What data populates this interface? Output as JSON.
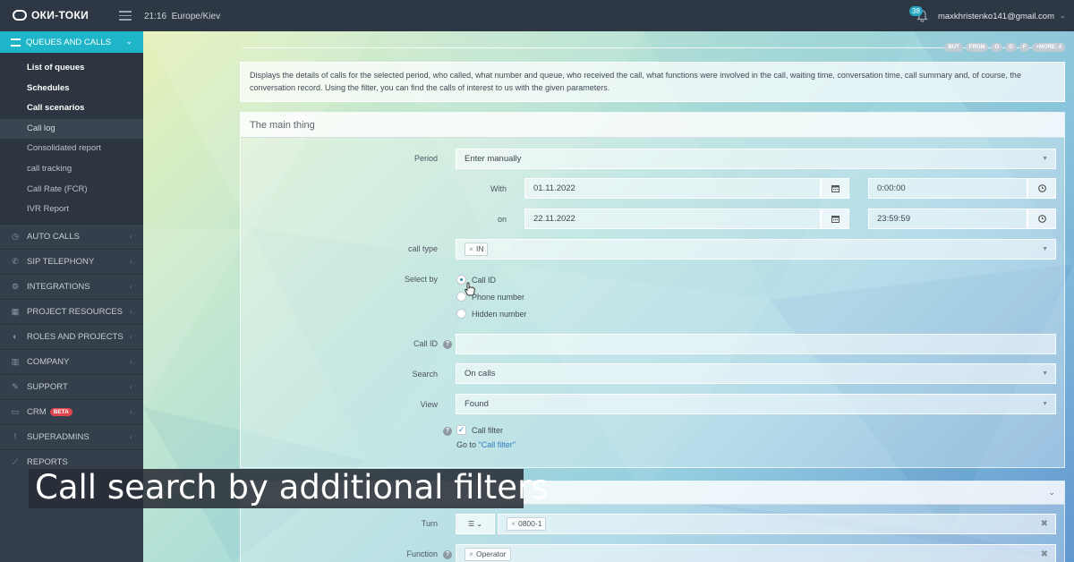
{
  "app": {
    "logo": "ОКИ-ТОКИ",
    "time": "21:16",
    "timezone": "Europe/Kiev"
  },
  "header": {
    "notifications": "38",
    "user": "maxkhristenko141@gmail.com"
  },
  "sidebar": {
    "active": {
      "label": "QUEUES AND CALLS",
      "icon": "list-icon"
    },
    "subitems": [
      {
        "label": "List of queues"
      },
      {
        "label": "Schedules"
      },
      {
        "label": "Call scenarios"
      },
      {
        "label": "Call log"
      },
      {
        "label": "Consolidated report"
      },
      {
        "label": "call tracking"
      },
      {
        "label": "Call Rate (FCR)"
      },
      {
        "label": "IVR Report"
      }
    ],
    "items": [
      {
        "label": "AUTO CALLS",
        "icon": "clock-icon"
      },
      {
        "label": "SIP TELEPHONY",
        "icon": "phone-icon"
      },
      {
        "label": "INTEGRATIONS",
        "icon": "gears-icon"
      },
      {
        "label": "PROJECT RESOURCES",
        "icon": "grid-icon"
      },
      {
        "label": "ROLES AND PROJECTS",
        "icon": "toggle-icon"
      },
      {
        "label": "COMPANY",
        "icon": "chart-icon"
      },
      {
        "label": "SUPPORT",
        "icon": "wrench-icon"
      },
      {
        "label": "CRM",
        "icon": "crm-icon",
        "badge": "BETA"
      },
      {
        "label": "SUPERADMINS",
        "icon": "exclamation-icon"
      },
      {
        "label": "REPORTS",
        "icon": "line-chart-icon"
      }
    ]
  },
  "pills": [
    "BUT",
    "FROM",
    "O",
    "G",
    "F",
    "+MORE: 4"
  ],
  "description": "Displays the details of calls for the selected period, who called, what number and queue, who received the call, what functions were involved in the call, waiting time, conversation time, call summary and, of course, the conversation record. Using the filter, you can find the calls of interest to us with the given parameters.",
  "form": {
    "title": "The main thing",
    "period_label": "Period",
    "period_value": "Enter manually",
    "with_label": "With",
    "with_date": "01.11.2022",
    "with_time": "0:00:00",
    "on_label": "on",
    "on_date": "22.11.2022",
    "on_time": "23:59:59",
    "call_type_label": "call type",
    "call_type_tag": "IN",
    "select_by_label": "Select by",
    "select_options": [
      "Call ID",
      "Phone number",
      "Hidden number"
    ],
    "call_id_label": "Call ID",
    "call_id_value": "",
    "search_label": "Search",
    "search_value": "On calls",
    "view_label": "View",
    "view_value": "Found",
    "call_filter_label": "Call filter",
    "goto_prefix": "Go to ",
    "goto_link": "\"Call filter\""
  },
  "form2": {
    "turn_label": "Turn",
    "turn_tag": "0800-1",
    "function_label": "Function",
    "function_tag": "Operator"
  },
  "caption": "Call search by additional filters"
}
